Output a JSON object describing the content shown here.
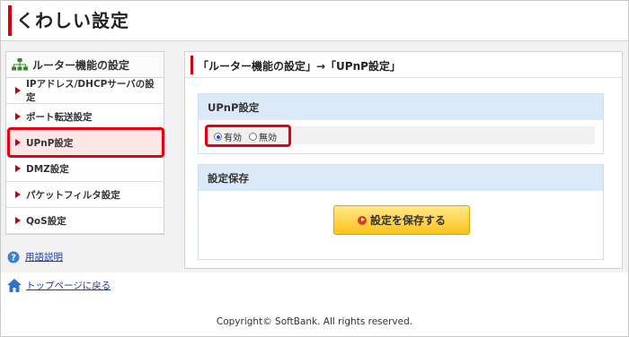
{
  "header": {
    "title": "くわしい設定"
  },
  "sidebar": {
    "heading": "ルーター機能の設定",
    "items": [
      {
        "label": "IPアドレス/DHCPサーバの設定"
      },
      {
        "label": "ポート転送設定"
      },
      {
        "label": "UPnP設定",
        "active": true
      },
      {
        "label": "DMZ設定"
      },
      {
        "label": "パケットフィルタ設定"
      },
      {
        "label": "QoS設定"
      }
    ]
  },
  "links": {
    "glossary": "用語説明",
    "top_page": "トップページに戻る"
  },
  "main": {
    "breadcrumb_title": "「ルーター機能の設定」→「UPnP設定」",
    "upnp_section": {
      "heading": "UPnP設定",
      "options": [
        {
          "label": "有効",
          "selected": true
        },
        {
          "label": "無効",
          "selected": false
        }
      ]
    },
    "save_section": {
      "heading": "設定保存",
      "button_label": "設定を保存する"
    }
  },
  "footer": {
    "copyright": "Copyright© SoftBank. All rights reserved."
  },
  "colors": {
    "brand_red": "#d7000f",
    "highlight": "#e60012",
    "section_blue": "#dce9f8",
    "button_yellow": "#ffc21a"
  }
}
